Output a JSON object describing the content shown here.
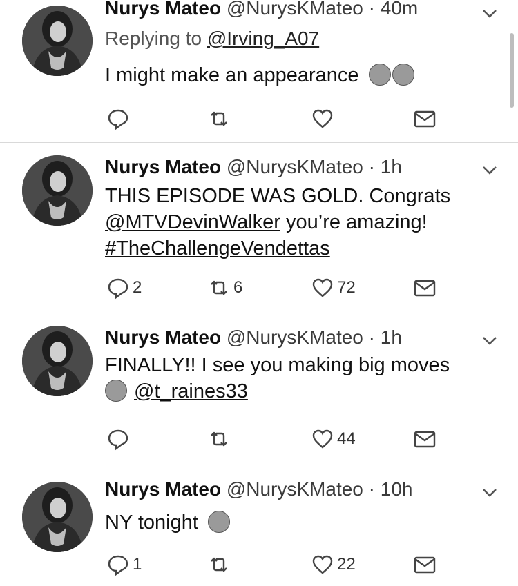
{
  "tweets": [
    {
      "name": "Nurys Mateo",
      "handle": "@NurysKMateo",
      "sep": "·",
      "time": "40m",
      "reply_prefix": "Replying to",
      "reply_to": "@Irving_A07",
      "text": "I might make an appearance",
      "emojis": [
        "relieved-face-emoji",
        "shushing-face-emoji"
      ],
      "replies": "",
      "retweets": "",
      "likes": ""
    },
    {
      "name": "Nurys Mateo",
      "handle": "@NurysKMateo",
      "sep": "·",
      "time": "1h",
      "line1": "THIS EPISODE WAS GOLD. Congrats",
      "mention": "@MTVDevinWalker",
      "line2_rest": " you’re amazing!",
      "hashtag": "#TheChallengeVendettas",
      "replies": "2",
      "retweets": "6",
      "likes": "72"
    },
    {
      "name": "Nurys Mateo",
      "handle": "@NurysKMateo",
      "sep": "·",
      "time": "1h",
      "line1": "FINALLY!! I see you making big moves",
      "emoji": "smiling-devil-emoji",
      "mention": "@t_raines33",
      "replies": "",
      "retweets": "",
      "likes": "44"
    },
    {
      "name": "Nurys Mateo",
      "handle": "@NurysKMateo",
      "sep": "·",
      "time": "10h",
      "text": "NY tonight",
      "emoji": "hugging-face-emoji",
      "replies": "1",
      "retweets": "",
      "likes": "22"
    }
  ]
}
